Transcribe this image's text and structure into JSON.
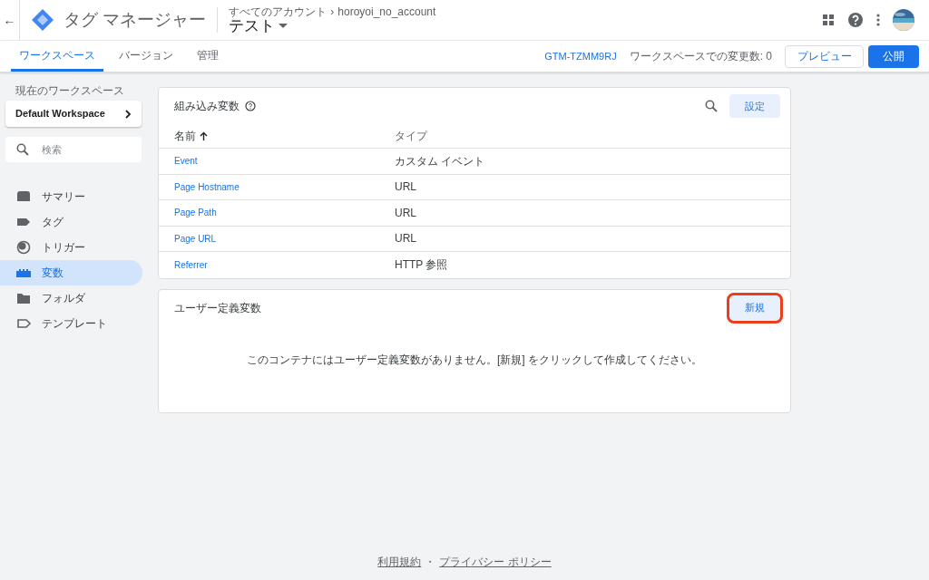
{
  "header": {
    "back": "←",
    "product": "タグ マネージャー",
    "breadcrumb": "すべてのアカウント",
    "breadcrumb_separator": "›",
    "account": "horoyoi_no_account",
    "container": "テスト"
  },
  "tabs": [
    {
      "label": "ワークスペース",
      "selected": true
    },
    {
      "label": "バージョン",
      "selected": false
    },
    {
      "label": "管理",
      "selected": false
    }
  ],
  "toolbar": {
    "container_id": "GTM-TZMM9RJ",
    "changes": "ワークスペースでの変更数: 0",
    "preview": "プレビュー",
    "publish": "公開"
  },
  "sidebar": {
    "workspace_label": "現在のワークスペース",
    "workspace": "Default Workspace",
    "search_placeholder": "検索",
    "items": [
      {
        "kind": "summary",
        "label": "サマリー",
        "selected": false
      },
      {
        "kind": "tag",
        "label": "タグ",
        "selected": false
      },
      {
        "kind": "trigger",
        "label": "トリガー",
        "selected": false
      },
      {
        "kind": "variable",
        "label": "変数",
        "selected": true
      },
      {
        "kind": "folder",
        "label": "フォルダ",
        "selected": false
      },
      {
        "kind": "template",
        "label": "テンプレート",
        "selected": false
      }
    ]
  },
  "builtin": {
    "title": "組み込み変数",
    "button": "設定",
    "columns": [
      "名前",
      "タイプ"
    ],
    "rows": [
      [
        "Event",
        "カスタム イベント"
      ],
      [
        "Page Hostname",
        "URL"
      ],
      [
        "Page Path",
        "URL"
      ],
      [
        "Page URL",
        "URL"
      ],
      [
        "Referrer",
        "HTTP 参照"
      ]
    ]
  },
  "user_defined": {
    "title": "ユーザー定義変数",
    "button": "新規",
    "button_highlighted": true,
    "empty_message": "このコンテナにはユーザー定義変数がありません。[新規] をクリックして作成してください。"
  },
  "footer": {
    "links": [
      "利用規約",
      "プライバシー ポリシー"
    ],
    "separator": "・"
  }
}
